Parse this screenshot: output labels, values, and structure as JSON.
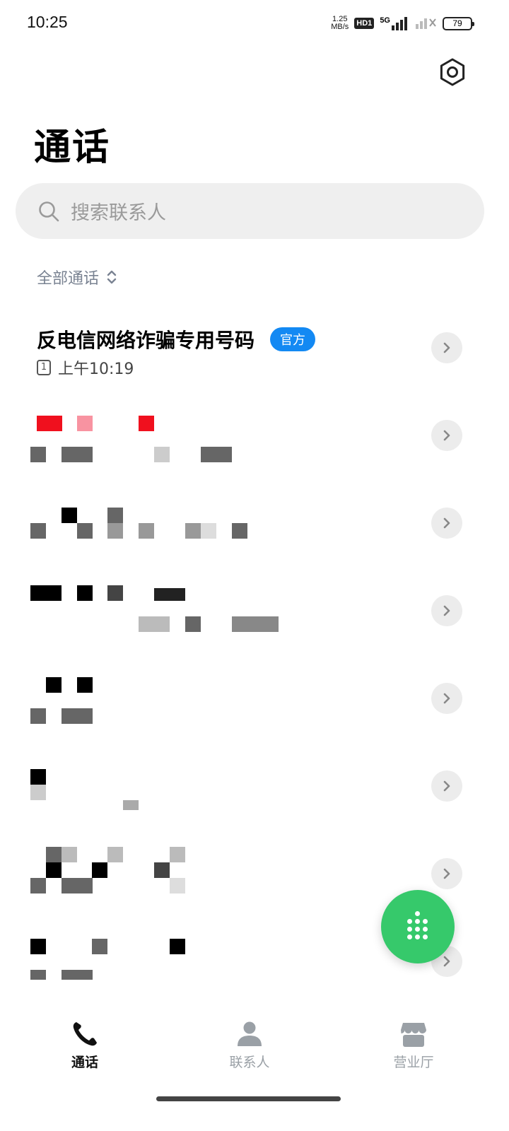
{
  "status_bar": {
    "time": "10:25",
    "net_speed_value": "1.25",
    "net_speed_unit": "MB/s",
    "hd_badge": "HD1",
    "network": "5G",
    "battery": "79"
  },
  "header": {
    "title": "通话"
  },
  "search": {
    "placeholder": "搜索联系人"
  },
  "filter": {
    "label": "全部通话"
  },
  "calls": [
    {
      "name": "反电信网络诈骗专用号码",
      "badge": "官方",
      "sim": "1",
      "time": "上午10:19"
    }
  ],
  "bottom_nav": [
    {
      "label": "通话",
      "icon": "phone-icon",
      "active": true
    },
    {
      "label": "联系人",
      "icon": "person-icon",
      "active": false
    },
    {
      "label": "营业厅",
      "icon": "store-icon",
      "active": false
    }
  ],
  "colors": {
    "accent_blue": "#1389f3",
    "fab_green": "#36c96b",
    "nav_inactive": "#9aa0a6"
  }
}
